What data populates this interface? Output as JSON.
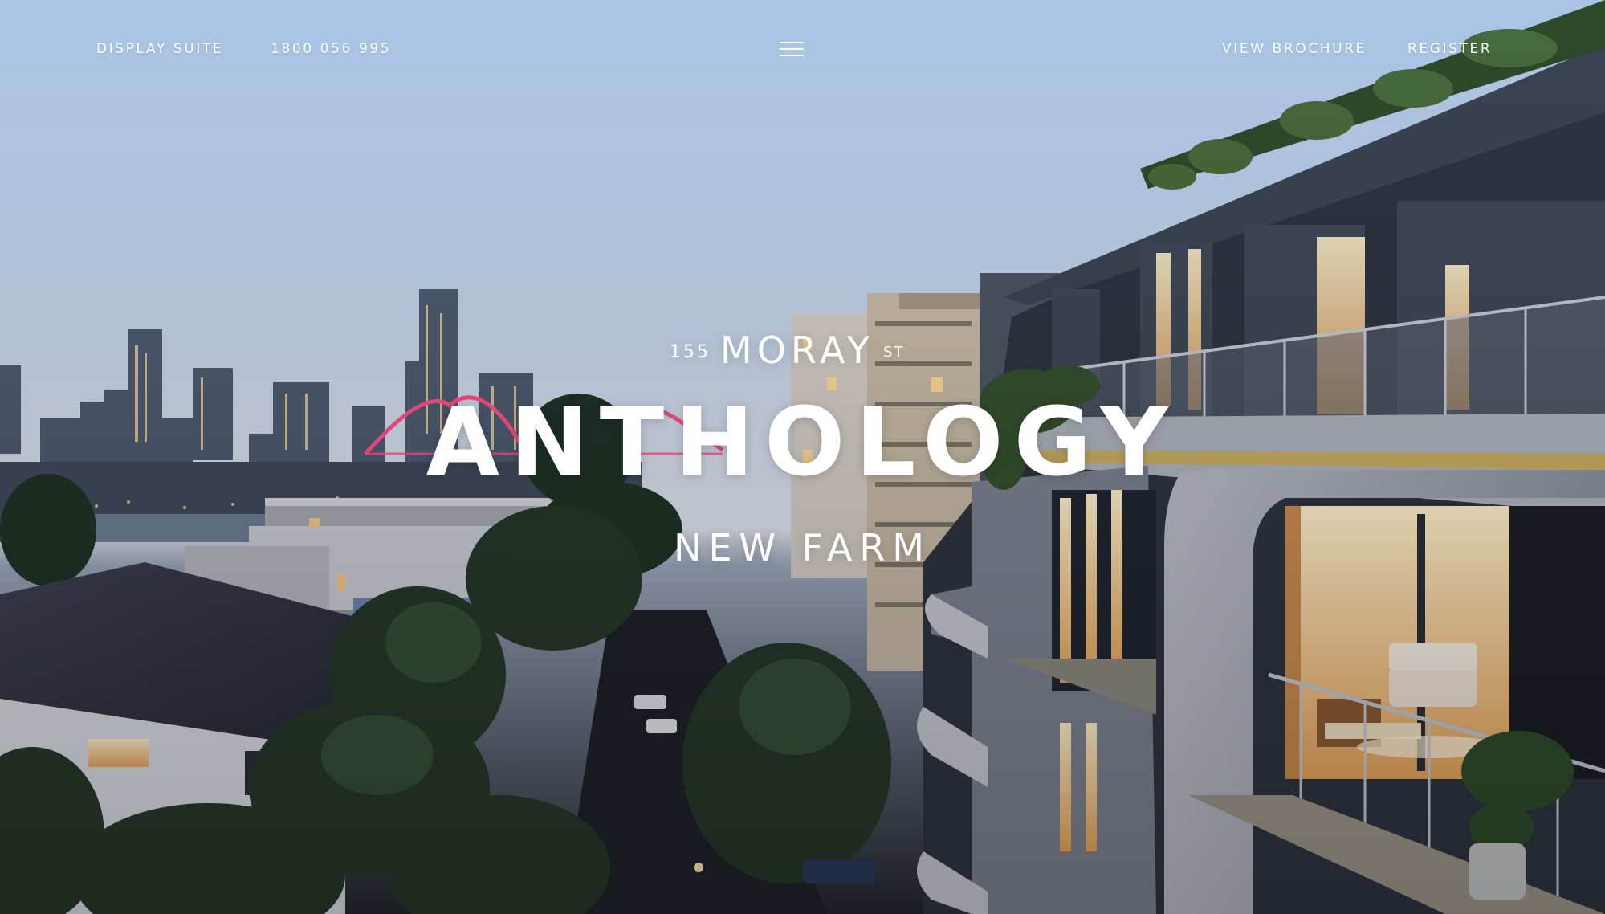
{
  "header": {
    "display_suite_label": "DISPLAY SUITE",
    "phone": "1800 056 995",
    "view_brochure_label": "VIEW BROCHURE",
    "register_label": "REGISTER",
    "menu_icon": "hamburger-menu-icon"
  },
  "hero": {
    "street_number": "155",
    "street_name": "MORAY",
    "street_suffix": "ST",
    "development_name": "ANTHOLOGY",
    "suburb": "NEW FARM"
  },
  "colors": {
    "text": "#ffffff",
    "bridge_lights": "#ff4f86",
    "warm_interior": "#ffd9a3"
  }
}
